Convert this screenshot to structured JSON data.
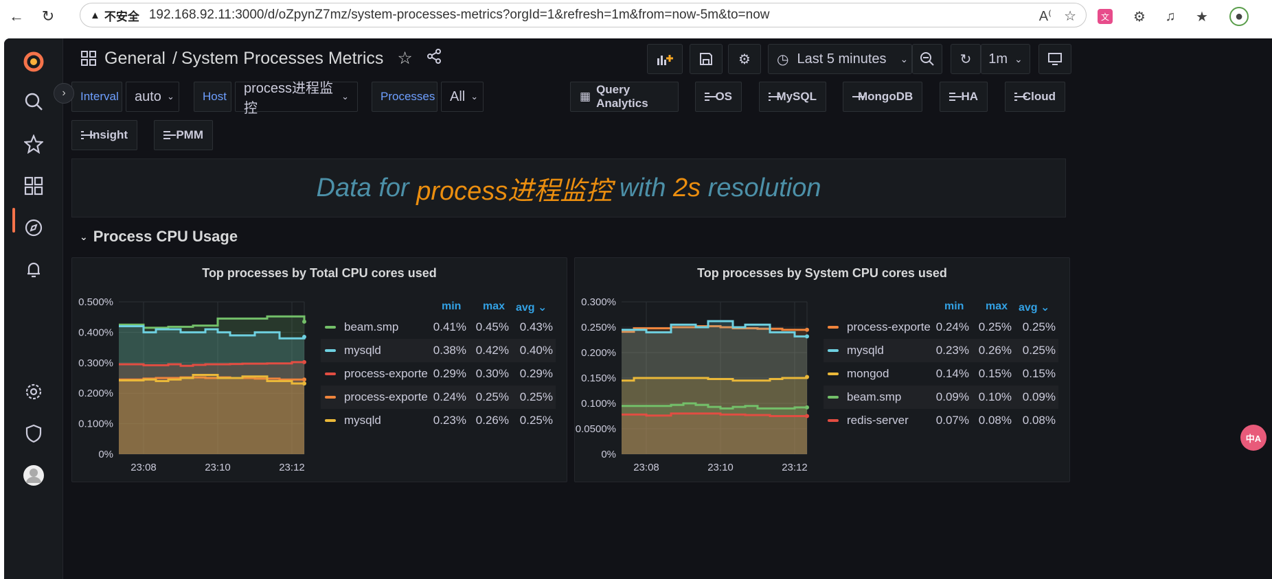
{
  "browser": {
    "insecure_label": "不安全",
    "url": "192.168.92.11:3000/d/oZpynZ7mz/system-processes-metrics?orgId=1&refresh=1m&from=now-5m&to=now"
  },
  "header": {
    "folder": "General",
    "separator": "/",
    "title": "System Processes Metrics",
    "time_range": "Last 5 minutes",
    "refresh": "1m"
  },
  "variables": [
    {
      "label": "Interval",
      "value": "auto"
    },
    {
      "label": "Host",
      "value": "process进程监控"
    },
    {
      "label": "Processes",
      "value": "All"
    }
  ],
  "links": [
    "Query Analytics",
    "OS",
    "MySQL",
    "MongoDB",
    "HA",
    "Cloud",
    "Insight",
    "PMM"
  ],
  "banner": {
    "part1": "Data for ",
    "host": "process进程监控",
    "part2": " with ",
    "res": "2s",
    "part3": " resolution"
  },
  "row_title": "Process CPU Usage",
  "legend_cols": {
    "min": "min",
    "max": "max",
    "avg": "avg"
  },
  "colors": {
    "green": "#73bf69",
    "cyan": "#6ed0e0",
    "red": "#e24d42",
    "orange": "#ef843c",
    "yellow": "#eab839"
  },
  "chart_data": [
    {
      "type": "area",
      "title": "Top processes by Total CPU cores used",
      "x": [
        "23:07:20",
        "23:07:40",
        "23:08:00",
        "23:08:20",
        "23:08:40",
        "23:09:00",
        "23:09:20",
        "23:09:40",
        "23:10:00",
        "23:10:20",
        "23:10:40",
        "23:11:00",
        "23:11:20",
        "23:11:40",
        "23:12:00",
        "23:12:20"
      ],
      "x_ticks": [
        "23:08",
        "23:10",
        "23:12"
      ],
      "y_ticks": [
        "0%",
        "0.100%",
        "0.200%",
        "0.300%",
        "0.400%",
        "0.500%"
      ],
      "ylim": [
        0,
        0.5
      ],
      "stacked": false,
      "series": [
        {
          "name": "beam.smp",
          "color": "#73bf69",
          "min": "0.41%",
          "max": "0.45%",
          "avg": "0.43%",
          "values": [
            0.425,
            0.425,
            0.415,
            0.415,
            0.418,
            0.418,
            0.422,
            0.422,
            0.445,
            0.445,
            0.445,
            0.445,
            0.452,
            0.452,
            0.452,
            0.435
          ]
        },
        {
          "name": "mysqld",
          "color": "#6ed0e0",
          "min": "0.38%",
          "max": "0.42%",
          "avg": "0.40%",
          "values": [
            0.42,
            0.42,
            0.4,
            0.41,
            0.41,
            0.4,
            0.4,
            0.41,
            0.4,
            0.39,
            0.39,
            0.4,
            0.4,
            0.38,
            0.38,
            0.385
          ]
        },
        {
          "name": "process-exporte",
          "color": "#e24d42",
          "min": "0.29%",
          "max": "0.30%",
          "avg": "0.29%",
          "values": [
            0.295,
            0.295,
            0.292,
            0.292,
            0.295,
            0.29,
            0.293,
            0.295,
            0.295,
            0.296,
            0.297,
            0.297,
            0.298,
            0.298,
            0.302,
            0.302
          ]
        },
        {
          "name": "process-exporte",
          "color": "#ef843c",
          "min": "0.24%",
          "max": "0.25%",
          "avg": "0.25%",
          "values": [
            0.245,
            0.245,
            0.248,
            0.25,
            0.25,
            0.252,
            0.252,
            0.25,
            0.252,
            0.25,
            0.25,
            0.248,
            0.248,
            0.245,
            0.245,
            0.245
          ]
        },
        {
          "name": "mysqld",
          "color": "#eab839",
          "min": "0.23%",
          "max": "0.26%",
          "avg": "0.25%",
          "values": [
            0.242,
            0.242,
            0.245,
            0.24,
            0.245,
            0.25,
            0.26,
            0.26,
            0.25,
            0.25,
            0.255,
            0.255,
            0.24,
            0.24,
            0.232,
            0.232
          ]
        }
      ]
    },
    {
      "type": "area",
      "title": "Top processes by System CPU cores used",
      "x": [
        "23:07:20",
        "23:07:40",
        "23:08:00",
        "23:08:20",
        "23:08:40",
        "23:09:00",
        "23:09:20",
        "23:09:40",
        "23:10:00",
        "23:10:20",
        "23:10:40",
        "23:11:00",
        "23:11:20",
        "23:11:40",
        "23:12:00",
        "23:12:20"
      ],
      "x_ticks": [
        "23:08",
        "23:10",
        "23:12"
      ],
      "y_ticks": [
        "0%",
        "0.0500%",
        "0.100%",
        "0.150%",
        "0.200%",
        "0.250%",
        "0.300%"
      ],
      "ylim": [
        0,
        0.3
      ],
      "stacked": false,
      "series": [
        {
          "name": "process-exporte",
          "color": "#ef843c",
          "min": "0.24%",
          "max": "0.25%",
          "avg": "0.25%",
          "values": [
            0.241,
            0.248,
            0.248,
            0.248,
            0.25,
            0.25,
            0.252,
            0.252,
            0.25,
            0.248,
            0.248,
            0.247,
            0.247,
            0.245,
            0.245,
            0.245
          ]
        },
        {
          "name": "mysqld",
          "color": "#6ed0e0",
          "min": "0.23%",
          "max": "0.26%",
          "avg": "0.25%",
          "values": [
            0.245,
            0.245,
            0.24,
            0.24,
            0.255,
            0.255,
            0.25,
            0.262,
            0.262,
            0.25,
            0.255,
            0.255,
            0.24,
            0.24,
            0.232,
            0.232
          ]
        },
        {
          "name": "mongod",
          "color": "#eab839",
          "min": "0.14%",
          "max": "0.15%",
          "avg": "0.15%",
          "values": [
            0.145,
            0.15,
            0.15,
            0.15,
            0.15,
            0.15,
            0.15,
            0.148,
            0.148,
            0.145,
            0.145,
            0.145,
            0.148,
            0.15,
            0.15,
            0.152
          ]
        },
        {
          "name": "beam.smp",
          "color": "#73bf69",
          "min": "0.09%",
          "max": "0.10%",
          "avg": "0.09%",
          "values": [
            0.095,
            0.095,
            0.095,
            0.095,
            0.097,
            0.1,
            0.097,
            0.093,
            0.09,
            0.093,
            0.095,
            0.09,
            0.09,
            0.09,
            0.092,
            0.092
          ]
        },
        {
          "name": "redis-server",
          "color": "#e24d42",
          "min": "0.07%",
          "max": "0.08%",
          "avg": "0.08%",
          "values": [
            0.078,
            0.078,
            0.076,
            0.076,
            0.08,
            0.08,
            0.08,
            0.08,
            0.078,
            0.078,
            0.077,
            0.077,
            0.075,
            0.075,
            0.075,
            0.075
          ]
        }
      ]
    }
  ]
}
